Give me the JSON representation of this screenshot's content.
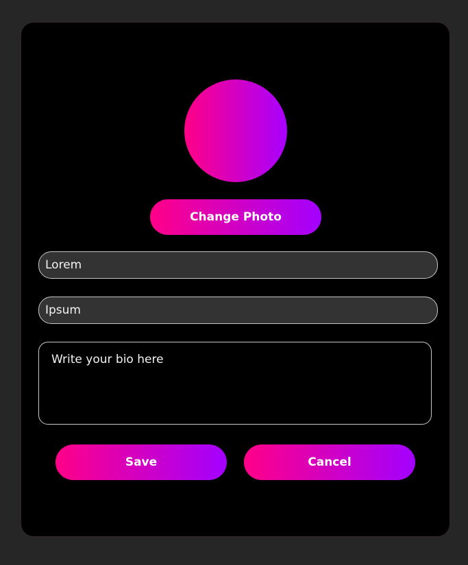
{
  "profile": {
    "avatar_gradient": [
      "#ff0086",
      "#a800ff"
    ],
    "change_photo_label": "Change Photo"
  },
  "form": {
    "first_name_value": "Lorem",
    "last_name_value": "Ipsum",
    "bio_placeholder": "Write your bio here"
  },
  "actions": {
    "save_label": "Save",
    "cancel_label": "Cancel"
  },
  "colors": {
    "page_bg": "#262626",
    "card_bg": "#000000",
    "field_bg": "#333333",
    "field_border": "#c8c8c8",
    "accent_start": "#ff0088",
    "accent_end": "#a300ff"
  }
}
